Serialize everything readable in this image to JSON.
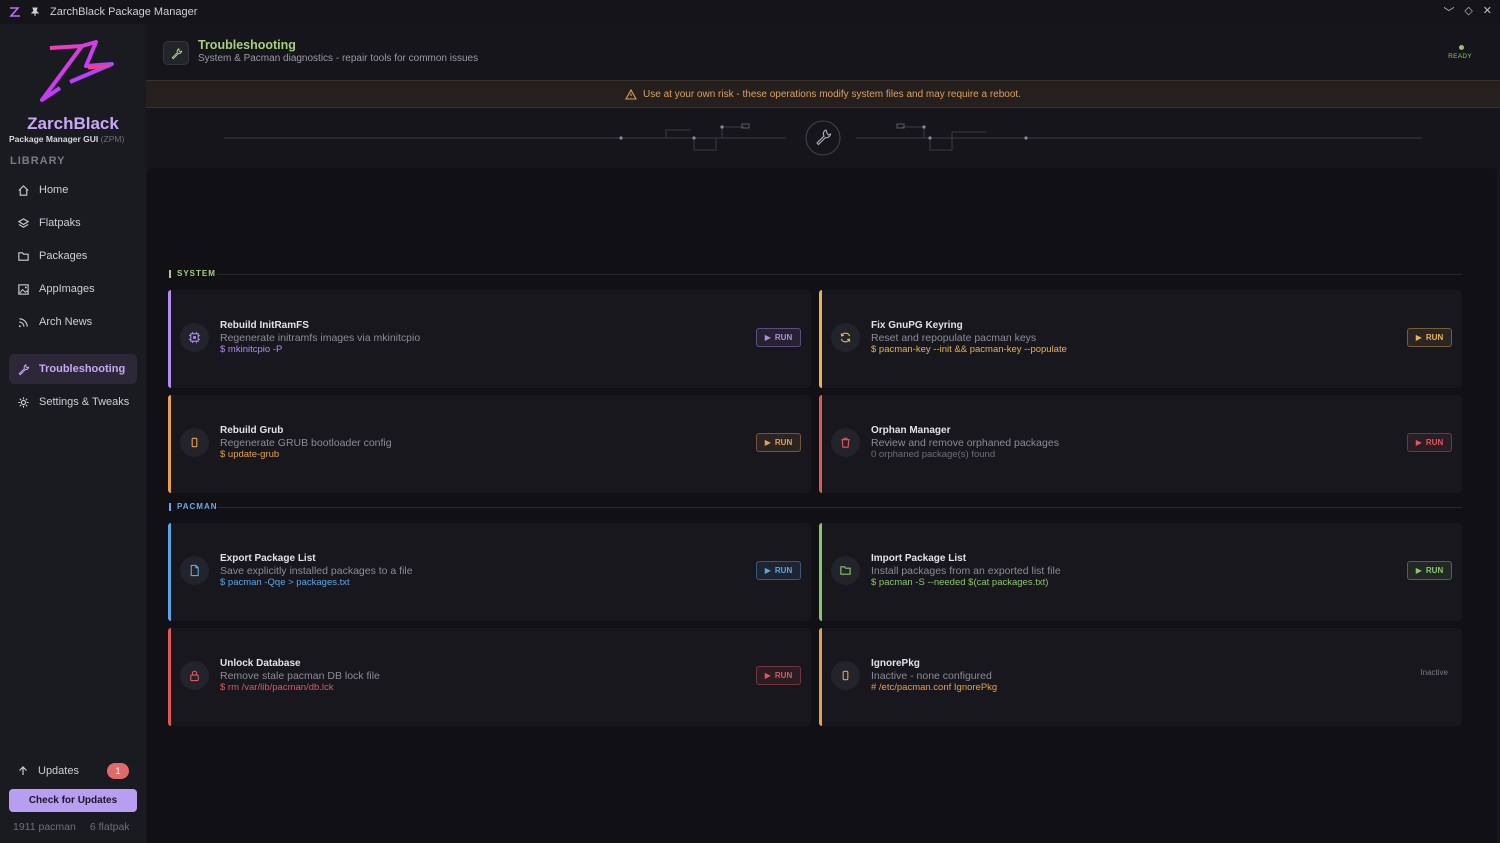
{
  "window": {
    "title": "ZarchBlack Package Manager"
  },
  "sidebar": {
    "brand": "ZarchBlack",
    "brand_sub": "Package Manager GUI",
    "brand_abbr": "(ZPM)",
    "library_label": "LIBRARY",
    "items": [
      {
        "label": "Home",
        "icon": "home-icon"
      },
      {
        "label": "Flatpaks",
        "icon": "layers-icon"
      },
      {
        "label": "Packages",
        "icon": "folder-icon"
      },
      {
        "label": "AppImages",
        "icon": "image-icon"
      },
      {
        "label": "Arch News",
        "icon": "rss-icon"
      },
      {
        "label": "Troubleshooting",
        "icon": "wrench-icon",
        "active": true
      },
      {
        "label": "Settings & Tweaks",
        "icon": "gear-icon"
      }
    ],
    "updates_label": "Updates",
    "updates_count": "1",
    "check_button": "Check for Updates",
    "pacman_count": "1911 pacman",
    "flatpak_count": "6 flatpak"
  },
  "header": {
    "title": "Troubleshooting",
    "subtitle": "System & Pacman diagnostics - repair tools for common issues",
    "status": "READY"
  },
  "warning": {
    "text": "Use at your own risk - these operations modify system files and may require a reboot."
  },
  "sections": {
    "system": "SYSTEM",
    "pacman": "PACMAN"
  },
  "run_label": "RUN",
  "cards": [
    {
      "title": "Rebuild InitRamFS",
      "desc": "Regenerate initramfs images via mkinitcpio",
      "cmd": "$ mkinitcpio -P",
      "color": "#b28cf0",
      "icon": "cpu-icon"
    },
    {
      "title": "Fix GnuPG Keyring",
      "desc": "Reset and repopulate pacman keys",
      "cmd": "$ pacman-key --init && pacman-key --populate",
      "color": "#e6b454",
      "icon": "refresh-icon"
    },
    {
      "title": "Rebuild Grub",
      "desc": "Regenerate GRUB bootloader config",
      "cmd": "$ update-grub",
      "color": "#e6a04e",
      "icon": "box-icon"
    },
    {
      "title": "Orphan Manager",
      "desc": "Review and remove orphaned packages",
      "cmd": "0 orphaned package(s) found",
      "color": "#e0575e",
      "icon": "trash-icon"
    },
    {
      "title": "Export Package List",
      "desc": "Save explicitly installed packages to a file",
      "cmd": "$ pacman -Qqe > packages.txt",
      "color": "#5aa7e8",
      "icon": "file-icon"
    },
    {
      "title": "Import Package List",
      "desc": "Install packages from an exported list file",
      "cmd": "$ pacman -S --needed $(cat packages.txt)",
      "color": "#8bc66a",
      "icon": "folder-icon"
    },
    {
      "title": "Unlock Database",
      "desc": "Remove stale pacman DB lock file",
      "cmd": "$ rm /var/lib/pacman/db.lck",
      "color": "#e0575e",
      "icon": "lock-icon"
    },
    {
      "title": "IgnorePkg",
      "desc": "Inactive - none configured",
      "cmd": "# /etc/pacman.conf IgnorePkg",
      "color": "#e6a04e",
      "icon": "box-icon",
      "inactive_label": "Inactive"
    }
  ]
}
